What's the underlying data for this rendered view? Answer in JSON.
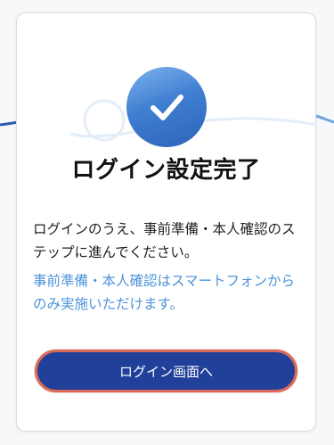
{
  "card": {
    "title": "ログイン設定完了",
    "body": "ログインのうえ、事前準備・本人確認のステップに進んでください。",
    "note": "事前準備・本人確認はスマートフォンからのみ実施いただけます。",
    "button_label": "ログイン画面へ"
  },
  "icons": {
    "success": "checkmark-icon"
  },
  "colors": {
    "accent_blue": "#3f7fd1",
    "button_bg": "#21409a",
    "button_border": "#d96a5a",
    "note_text": "#4d93d9"
  }
}
